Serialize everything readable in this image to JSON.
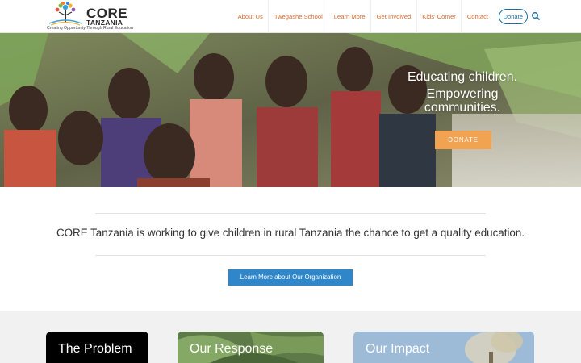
{
  "logo": {
    "name": "CORE",
    "subname": "TANZANIA",
    "tagline": "Creating Opportunity Through Rural Education"
  },
  "nav": {
    "items": [
      "About Us",
      "Twegashe School",
      "Learn More",
      "Get Involved",
      "Kids' Corner",
      "Contact"
    ],
    "donate_label": "Donate",
    "search_icon": "search-icon"
  },
  "hero": {
    "line1": "Educating children.",
    "line2": "Empowering",
    "line3": "communities.",
    "donate_label": "DONATE"
  },
  "mission": {
    "text": "CORE Tanzania is working to give children in rural Tanzania the chance to get a quality education.",
    "button_label": "Learn More about Our Organization"
  },
  "cards": [
    {
      "title": "The Problem"
    },
    {
      "title": "Our Response"
    },
    {
      "title": "Our Impact"
    }
  ],
  "colors": {
    "accent_orange": "#e06a2b",
    "donate_orange": "#f2a351",
    "button_blue": "#2f86c8",
    "link_blue": "#1e6fa3"
  }
}
